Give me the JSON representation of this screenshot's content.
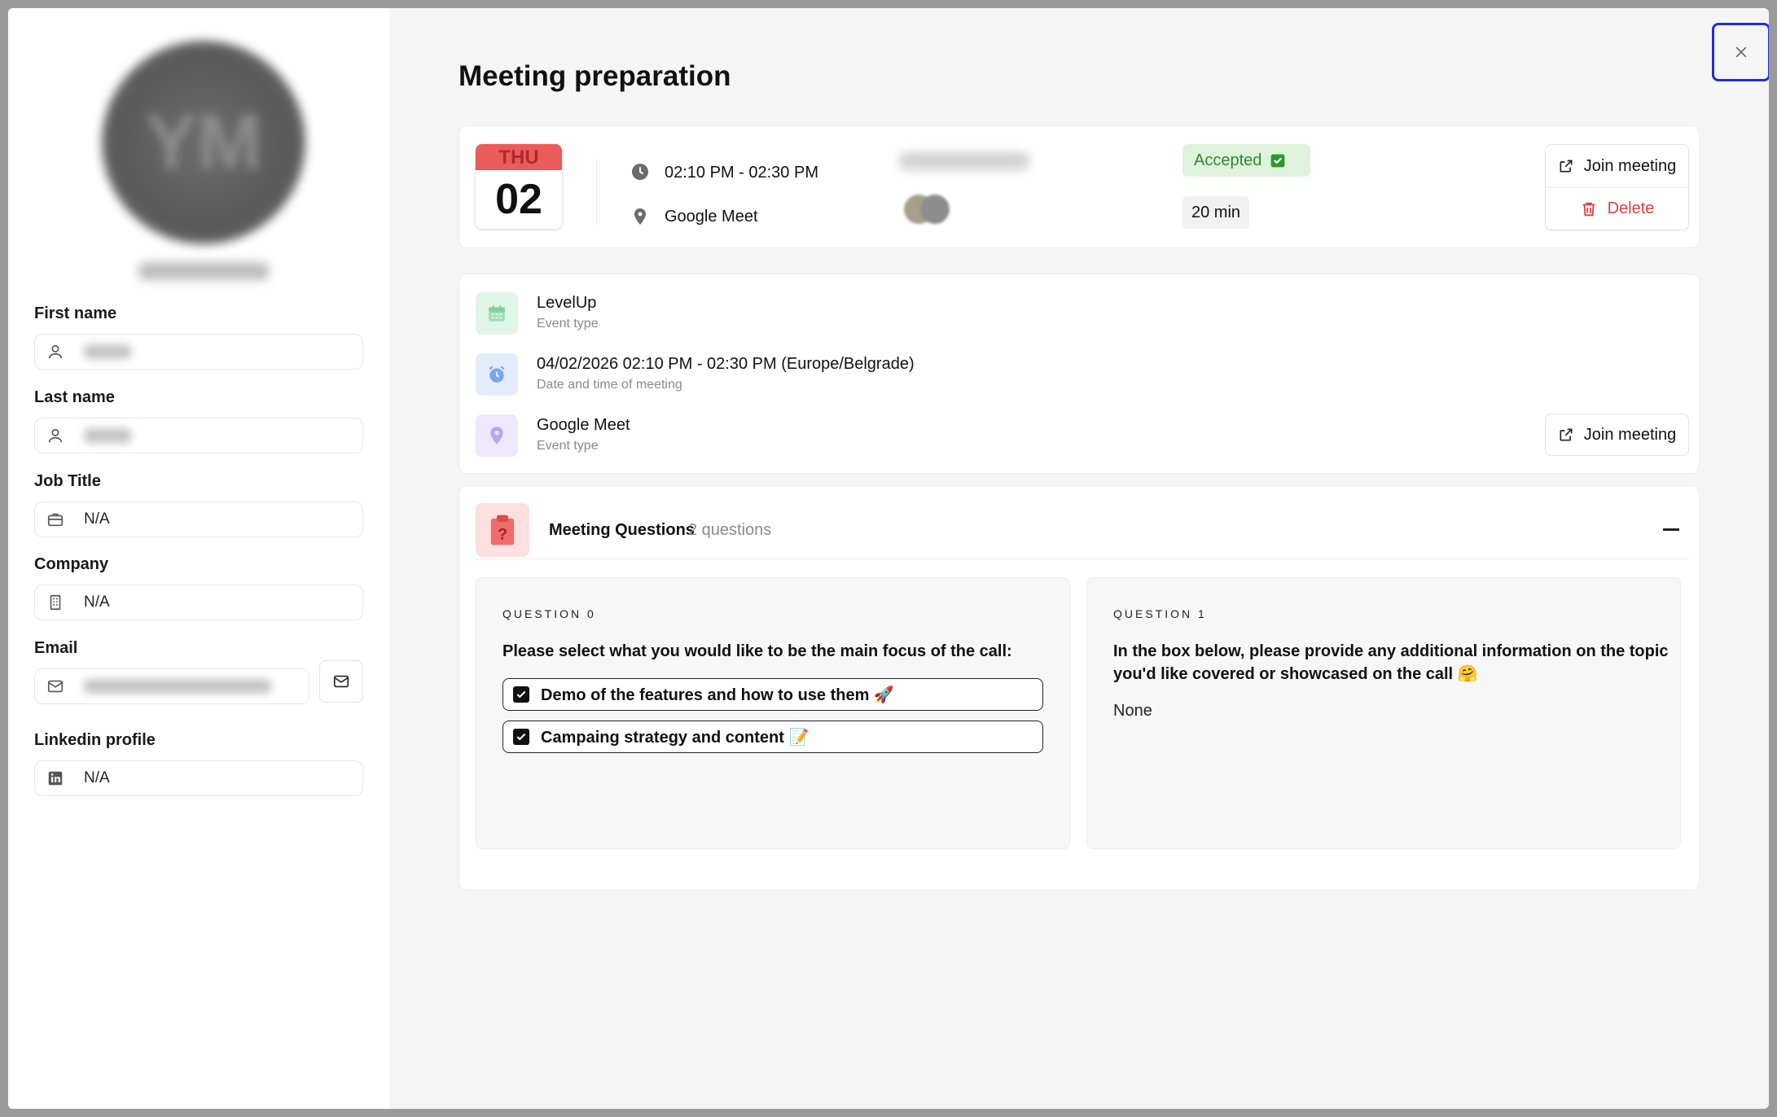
{
  "page_title": "Meeting preparation",
  "profile": {
    "avatar_initials": "YM",
    "fields": {
      "first_name": {
        "label": "First name"
      },
      "last_name": {
        "label": "Last name"
      },
      "job_title": {
        "label": "Job Title",
        "value": "N/A"
      },
      "company": {
        "label": "Company",
        "value": "N/A"
      },
      "email": {
        "label": "Email"
      },
      "linkedin": {
        "label": "Linkedin profile",
        "value": "N/A"
      }
    }
  },
  "summary": {
    "weekday": "THU",
    "day": "02",
    "time_range": "02:10 PM - 02:30 PM",
    "location": "Google Meet",
    "status": "Accepted",
    "duration": "20 min",
    "join_label": "Join meeting",
    "delete_label": "Delete"
  },
  "details": [
    {
      "title": "LevelUp",
      "subtitle": "Event type",
      "icon": "calendar-icon",
      "color": "#dff5e8"
    },
    {
      "title": "04/02/2026 02:10 PM - 02:30 PM (Europe/Belgrade)",
      "subtitle": "Date and time of meeting",
      "icon": "alarm-icon",
      "color": "#e3ecfc"
    },
    {
      "title": "Google Meet",
      "subtitle": "Event type",
      "icon": "location-icon",
      "color": "#ede8fb"
    }
  ],
  "details_join_label": "Join meeting",
  "questions_section": {
    "title": "Meeting Questions",
    "count": "2 questions",
    "q0": {
      "label": "QUESTION 0",
      "text": "Please select what you would like to be the main focus of the call:",
      "options": [
        "Demo of the features and how to use them 🚀",
        "Campaing strategy and content 📝"
      ]
    },
    "q1": {
      "label": "QUESTION 1",
      "text_line1": "In the box below, please provide any additional information on the topic",
      "text_line2": "you'd like covered or showcased on the call 🤗",
      "answer": "None"
    }
  },
  "colors": {
    "accent_red": "#ea5b5b",
    "accepted_green": "#2e8a2e",
    "focus_blue": "#1e2fd4"
  }
}
